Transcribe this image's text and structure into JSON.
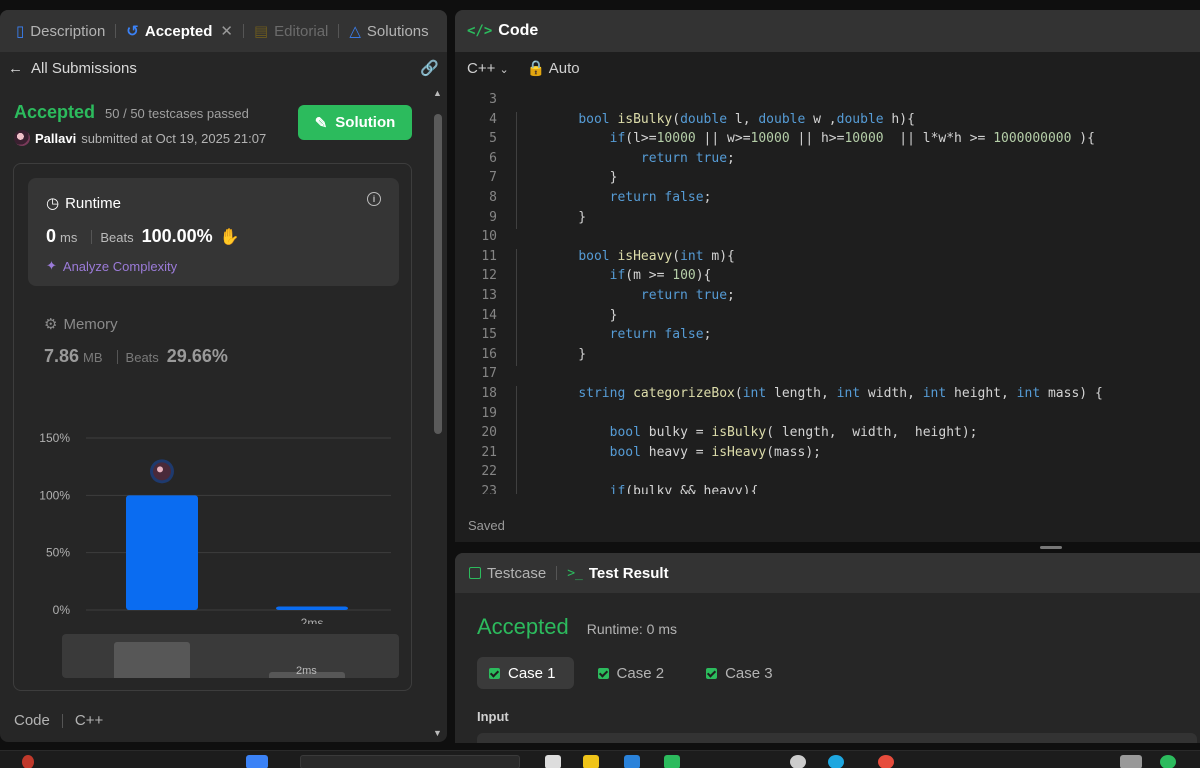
{
  "left": {
    "tabs": [
      {
        "label": "Description",
        "icon": "document-icon"
      },
      {
        "label": "Accepted",
        "icon": "history-icon"
      },
      {
        "label": "Editorial",
        "icon": "book-icon"
      },
      {
        "label": "Solutions",
        "icon": "flask-icon"
      }
    ],
    "all_submissions": "All Submissions",
    "status": "Accepted",
    "testcases": "50 / 50 testcases passed",
    "user": "Pallavi",
    "submitted_text": "submitted at Oct 19, 2025 21:07",
    "solution_label": "Solution",
    "runtime": {
      "title": "Runtime",
      "value": "0",
      "unit": "ms",
      "beats_label": "Beats",
      "beats": "100.00%",
      "analyze": "Analyze Complexity"
    },
    "memory": {
      "title": "Memory",
      "value": "7.86",
      "unit": "MB",
      "beats_label": "Beats",
      "beats": "29.66%"
    },
    "bottom": {
      "code": "Code",
      "lang": "C++"
    }
  },
  "chart_data": {
    "type": "bar",
    "categories": [
      "",
      "2ms"
    ],
    "values": [
      100,
      3
    ],
    "yticks": [
      "150%",
      "100%",
      "50%",
      "0%"
    ],
    "ylim": [
      0,
      150
    ],
    "minimap_label": "2ms",
    "colors": {
      "bar": "#0a6cf1",
      "grid": "#3d3d3d"
    }
  },
  "code": {
    "title": "Code",
    "language": "C++",
    "mode": "Auto",
    "saved": "Saved",
    "lines": [
      {
        "n": "3",
        "t": ""
      },
      {
        "n": "4",
        "t": "    bool isBulky(double l, double w ,double h){"
      },
      {
        "n": "5",
        "t": "        if(l>=10000 || w>=10000 || h>=10000  || l*w*h >= 1000000000 ){"
      },
      {
        "n": "6",
        "t": "            return true;"
      },
      {
        "n": "7",
        "t": "        }"
      },
      {
        "n": "8",
        "t": "        return false;"
      },
      {
        "n": "9",
        "t": "    }"
      },
      {
        "n": "10",
        "t": ""
      },
      {
        "n": "11",
        "t": "    bool isHeavy(int m){"
      },
      {
        "n": "12",
        "t": "        if(m >= 100){"
      },
      {
        "n": "13",
        "t": "            return true;"
      },
      {
        "n": "14",
        "t": "        }"
      },
      {
        "n": "15",
        "t": "        return false;"
      },
      {
        "n": "16",
        "t": "    }"
      },
      {
        "n": "17",
        "t": ""
      },
      {
        "n": "18",
        "t": "    string categorizeBox(int length, int width, int height, int mass) {"
      },
      {
        "n": "19",
        "t": ""
      },
      {
        "n": "20",
        "t": "        bool bulky = isBulky( length,  width,  height);"
      },
      {
        "n": "21",
        "t": "        bool heavy = isHeavy(mass);"
      },
      {
        "n": "22",
        "t": ""
      },
      {
        "n": "23",
        "t": "        if(bulky && heavy){"
      }
    ]
  },
  "test": {
    "tab_testcase": "Testcase",
    "tab_result": "Test Result",
    "status": "Accepted",
    "runtime": "Runtime: 0 ms",
    "cases": [
      "Case 1",
      "Case 2",
      "Case 3"
    ],
    "input_label": "Input"
  }
}
